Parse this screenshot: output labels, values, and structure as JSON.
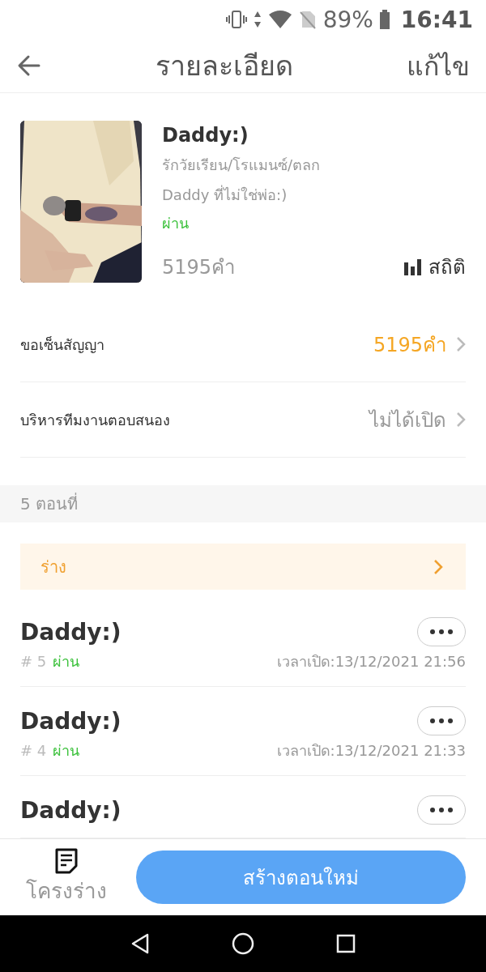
{
  "status_bar": {
    "battery": "89%",
    "time": "16:41"
  },
  "header": {
    "title": "รายละเอียด",
    "action": "แก้ไข"
  },
  "book": {
    "title": "Daddy:)",
    "tags": "รักวัยเรียน/โรแมนซ์/ตลก",
    "subtitle": "Daddy ที่ไม่ใช่พ่อ:)",
    "status": "ผ่าน",
    "word_count": "5195คำ",
    "stats_label": "สถิติ"
  },
  "settings": [
    {
      "label": "ขอเซ็นสัญญา",
      "value": "5195คำ",
      "kind": "highlight"
    },
    {
      "label": "บริหารทีมงานตอบสนอง",
      "value": "ไม่ได้เปิด",
      "kind": "plain"
    }
  ],
  "chapters_header": "5 ตอนที่",
  "draft": {
    "label": "ร่าง"
  },
  "chapters": [
    {
      "title": "Daddy:)",
      "number": "# 5",
      "status": "ผ่าน",
      "opened": "เวลาเปิด:13/12/2021 21:56"
    },
    {
      "title": "Daddy:)",
      "number": "# 4",
      "status": "ผ่าน",
      "opened": "เวลาเปิด:13/12/2021 21:33"
    },
    {
      "title": "Daddy:)"
    }
  ],
  "bottom": {
    "outline_label": "โครงร่าง",
    "create_button": "สร้างตอนใหม่"
  }
}
